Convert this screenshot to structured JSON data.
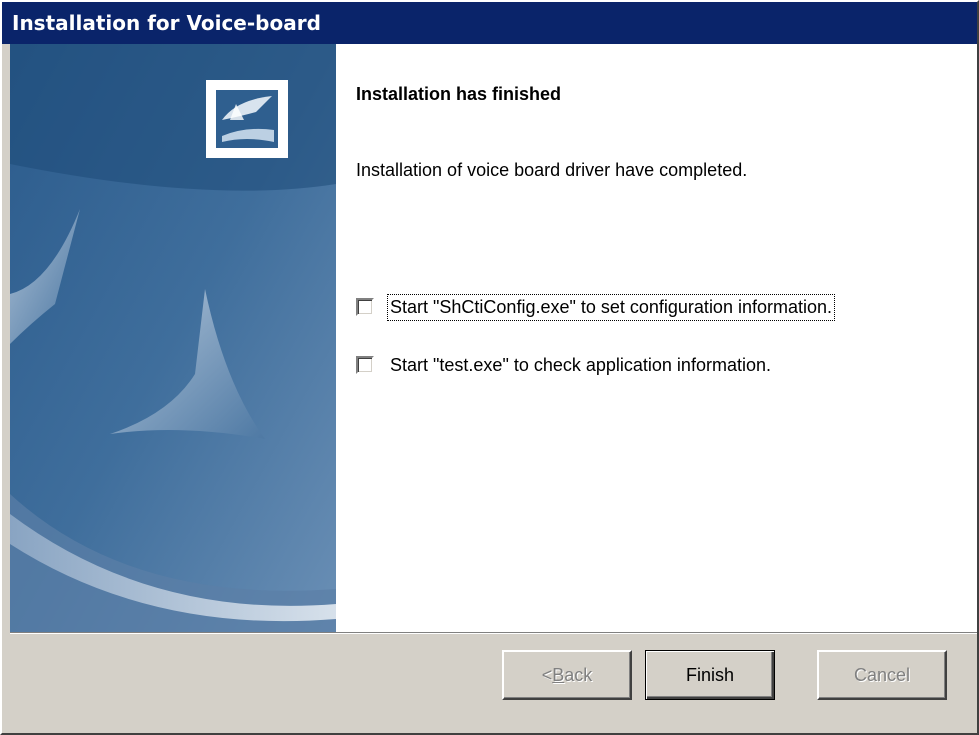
{
  "window": {
    "title": "Installation for Voice-board"
  },
  "banner": {
    "icon": "installer-logo-icon"
  },
  "main": {
    "heading": "Installation has finished",
    "description": "Installation of voice board driver have completed.",
    "options": [
      {
        "label": "Start \"ShCtiConfig.exe\" to set configuration information.",
        "checked": false,
        "focused": true
      },
      {
        "label": "Start \"test.exe\" to check application information.",
        "checked": false,
        "focused": false
      }
    ]
  },
  "buttons": {
    "back_prefix": "< ",
    "back_hotkey": "B",
    "back_rest": "ack",
    "back_enabled": false,
    "finish": "Finish",
    "finish_enabled": true,
    "cancel": "Cancel",
    "cancel_enabled": false
  },
  "colors": {
    "titlebar": "#0a246a",
    "face": "#d4d0c8",
    "banner_dark": "#1e4a78",
    "banner_light": "#5a7fa8"
  }
}
